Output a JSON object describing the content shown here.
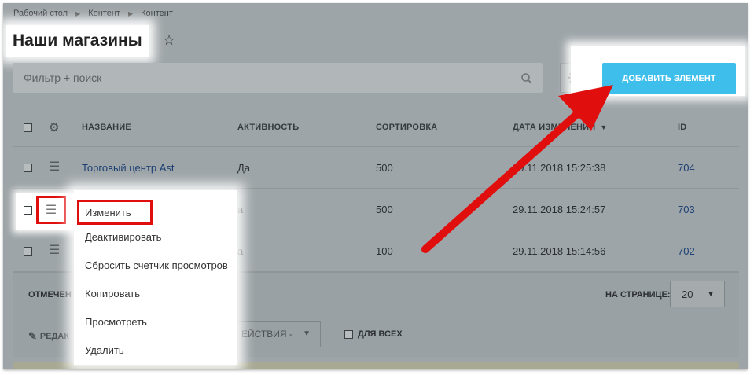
{
  "breadcrumb": [
    "Рабочий стол",
    "Контент",
    "Контент"
  ],
  "page_title": "Наши магазины",
  "search": {
    "placeholder": "Фильтр + поиск"
  },
  "toolbar": {
    "add_label": "ДОБАВИТЬ ЭЛЕМЕНТ"
  },
  "table": {
    "headers": {
      "name": "НАЗВАНИЕ",
      "active": "АКТИВНОСТЬ",
      "sort": "СОРТИРОВКА",
      "date": "ДАТА ИЗМЕНЕНИЯ",
      "id": "ID"
    },
    "rows": [
      {
        "name": "Торговый центр Ast",
        "active": "Да",
        "sort": "500",
        "date": "29.11.2018 15:25:38",
        "id": "704"
      },
      {
        "name": "",
        "active": "а",
        "sort": "500",
        "date": "29.11.2018 15:24:57",
        "id": "703"
      },
      {
        "name": "",
        "active": "а",
        "sort": "100",
        "date": "29.11.2018 15:14:56",
        "id": "702"
      }
    ]
  },
  "footer": {
    "marked_label": "ОТМЕЧЕН",
    "per_page_label": "НА СТРАНИЦЕ:",
    "per_page_value": "20"
  },
  "actions": {
    "edit_label": "РЕДАК",
    "select_label": "ЕЙСТВИЯ -",
    "for_all_label": "ДЛЯ ВСЕХ"
  },
  "context_menu": {
    "items": [
      "Изменить",
      "Деактивировать",
      "Сбросить счетчик просмотров",
      "Копировать",
      "Просмотреть",
      "Удалить"
    ]
  },
  "colors": {
    "accent": "#3ebeeb",
    "highlight": "#e10e0e",
    "link": "#1b3f73"
  }
}
